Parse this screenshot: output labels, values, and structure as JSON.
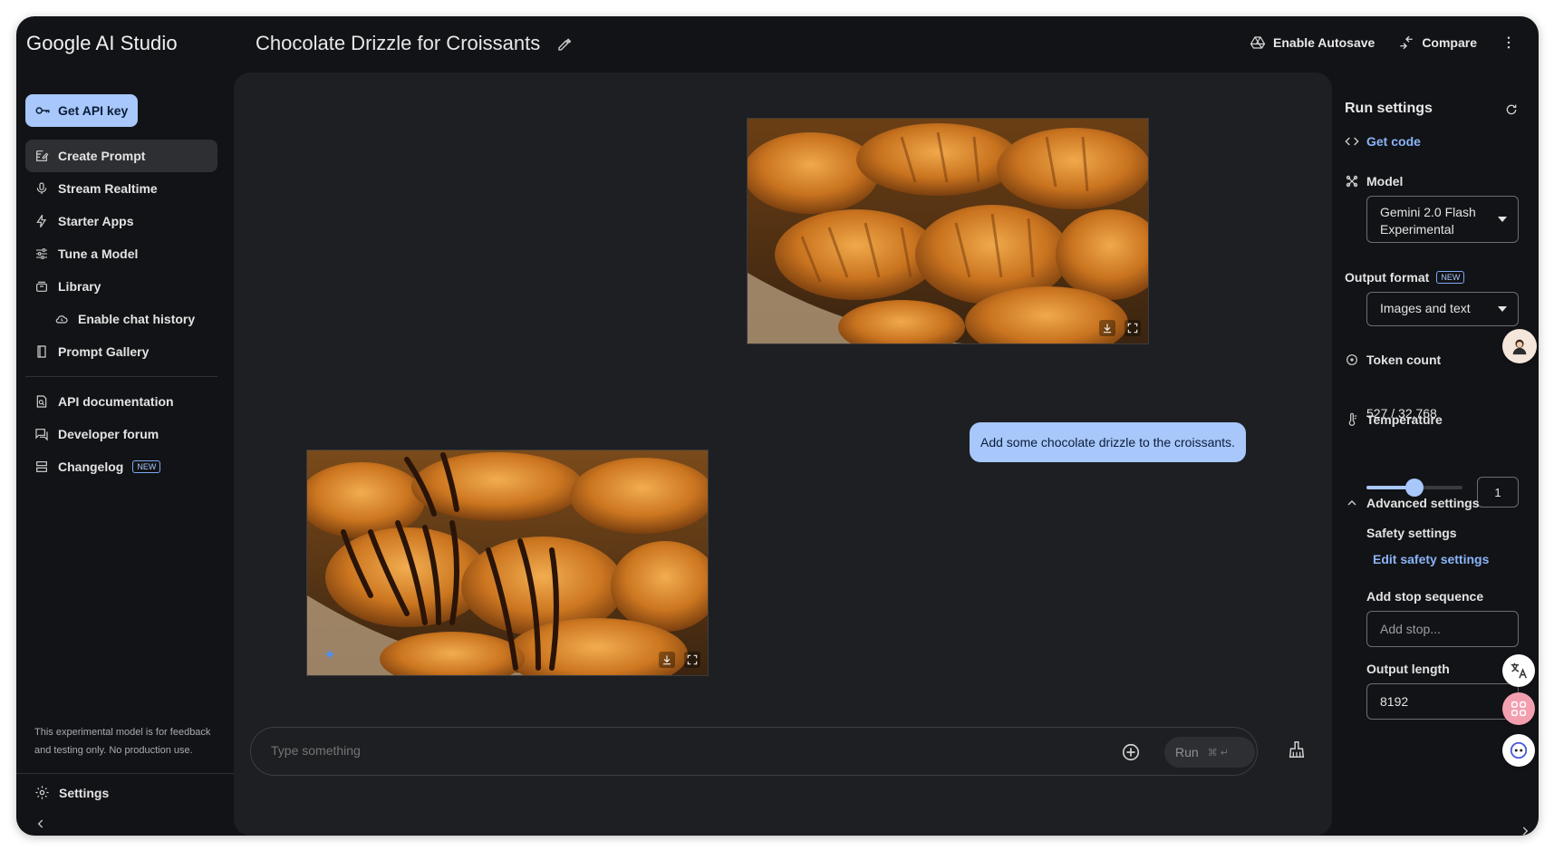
{
  "app": {
    "brand": "Google AI Studio"
  },
  "header": {
    "title": "Chocolate Drizzle for Croissants",
    "autosave_label": "Enable Autosave",
    "compare_label": "Compare"
  },
  "sidebar": {
    "api_key_label": "Get API key",
    "items": [
      {
        "label": "Create Prompt",
        "icon": "create-prompt-icon",
        "active": true
      },
      {
        "label": "Stream Realtime",
        "icon": "mic-icon"
      },
      {
        "label": "Starter Apps",
        "icon": "bolt-icon"
      },
      {
        "label": "Tune a Model",
        "icon": "tune-icon"
      },
      {
        "label": "Library",
        "icon": "library-icon"
      },
      {
        "label": "Enable chat history",
        "icon": "cloud-history-icon"
      },
      {
        "label": "Prompt Gallery",
        "icon": "book-icon"
      }
    ],
    "resources": [
      {
        "label": "API documentation",
        "icon": "doc-search-icon"
      },
      {
        "label": "Developer forum",
        "icon": "forum-icon"
      },
      {
        "label": "Changelog",
        "icon": "changelog-icon",
        "badge": "NEW"
      }
    ],
    "disclaimer": "This experimental model is for feedback and testing only. No production use.",
    "settings_label": "Settings"
  },
  "chat": {
    "user_message": "Add some chocolate drizzle to the croissants.",
    "composer_placeholder": "Type something",
    "run_label": "Run",
    "run_shortcut": "⌘ ↵"
  },
  "run_settings": {
    "title": "Run settings",
    "get_code_label": "Get code",
    "model_label": "Model",
    "model_value": "Gemini 2.0 Flash Experimental",
    "output_format_label": "Output format",
    "output_format_badge": "NEW",
    "output_format_value": "Images and text",
    "token_count_label": "Token count",
    "token_count_value": "527 / 32,768",
    "temperature_label": "Temperature",
    "temperature_value": "1",
    "temperature_fraction": 0.5,
    "advanced_label": "Advanced settings",
    "safety_label": "Safety settings",
    "safety_link": "Edit safety settings",
    "stop_sequence_label": "Add stop sequence",
    "stop_sequence_placeholder": "Add stop...",
    "output_length_label": "Output length",
    "output_length_value": "8192"
  },
  "colors": {
    "accent": "#a8c7fa",
    "link": "#8ab4f8",
    "background": "#121316",
    "panel": "#1e1f22"
  }
}
